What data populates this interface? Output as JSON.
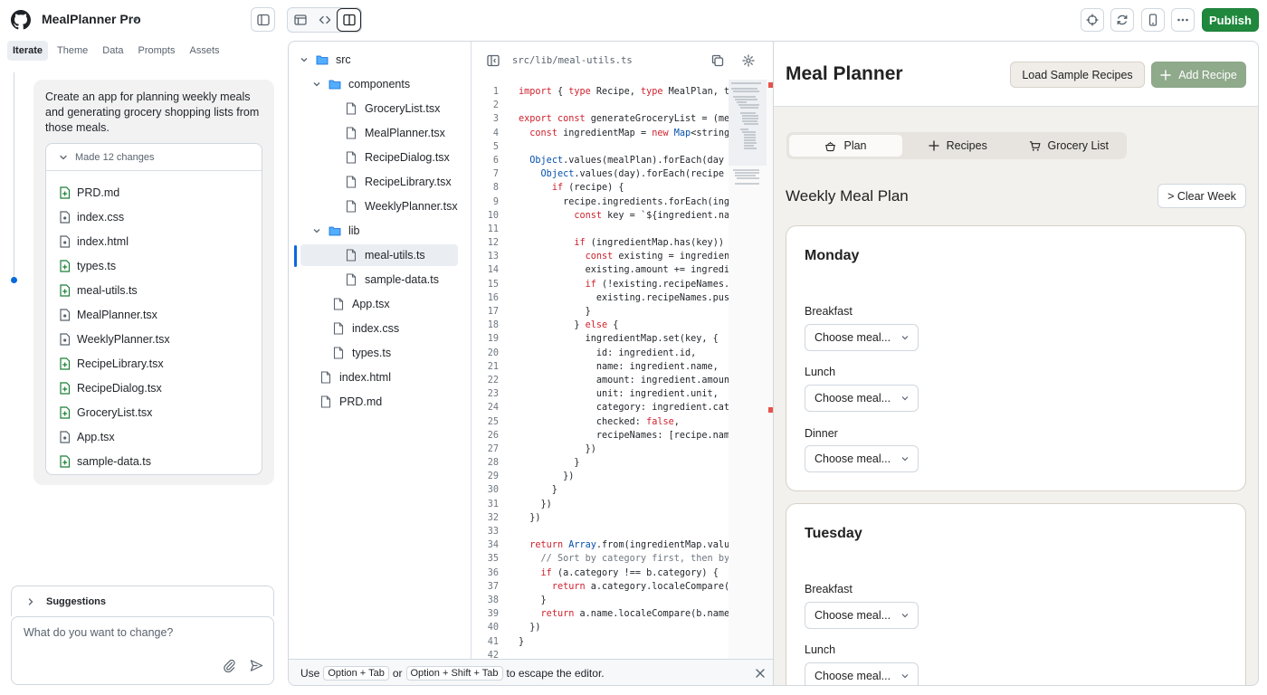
{
  "app": {
    "title": "MealPlanner Pro"
  },
  "header": {
    "publish_label": "Publish"
  },
  "left_tabs": [
    {
      "label": "Iterate",
      "active": true
    },
    {
      "label": "Theme"
    },
    {
      "label": "Data"
    },
    {
      "label": "Prompts"
    },
    {
      "label": "Assets"
    }
  ],
  "chat": {
    "message": "Create an app for planning weekly meals and generating grocery shopping lists from those meals.",
    "changes_label": "Made 12 changes",
    "files": [
      {
        "name": "PRD.md",
        "icon": "file-added-icon"
      },
      {
        "name": "index.css",
        "icon": "file-modified-icon"
      },
      {
        "name": "index.html",
        "icon": "file-modified-icon"
      },
      {
        "name": "types.ts",
        "icon": "file-added-icon"
      },
      {
        "name": "meal-utils.ts",
        "icon": "file-added-icon"
      },
      {
        "name": "MealPlanner.tsx",
        "icon": "file-modified-icon"
      },
      {
        "name": "WeeklyPlanner.tsx",
        "icon": "file-modified-icon"
      },
      {
        "name": "RecipeLibrary.tsx",
        "icon": "file-added-icon"
      },
      {
        "name": "RecipeDialog.tsx",
        "icon": "file-added-icon"
      },
      {
        "name": "GroceryList.tsx",
        "icon": "file-added-icon"
      },
      {
        "name": "App.tsx",
        "icon": "file-modified-icon"
      },
      {
        "name": "sample-data.ts",
        "icon": "file-added-icon"
      }
    ],
    "suggestions_label": "Suggestions",
    "input_placeholder": "What do you want to change?"
  },
  "tree": [
    {
      "name": "src",
      "type": "folder"
    },
    {
      "name": "components",
      "type": "folder"
    },
    {
      "name": "GroceryList.tsx",
      "type": "file"
    },
    {
      "name": "MealPlanner.tsx",
      "type": "file"
    },
    {
      "name": "RecipeDialog.tsx",
      "type": "file"
    },
    {
      "name": "RecipeLibrary.tsx",
      "type": "file"
    },
    {
      "name": "WeeklyPlanner.tsx",
      "type": "file"
    },
    {
      "name": "lib",
      "type": "folder"
    },
    {
      "name": "meal-utils.ts",
      "type": "file",
      "selected": true
    },
    {
      "name": "sample-data.ts",
      "type": "file"
    },
    {
      "name": "App.tsx",
      "type": "file"
    },
    {
      "name": "index.css",
      "type": "file"
    },
    {
      "name": "types.ts",
      "type": "file"
    },
    {
      "name": "index.html",
      "type": "file"
    },
    {
      "name": "PRD.md",
      "type": "file"
    }
  ],
  "editor": {
    "path": "src/lib/meal-utils.ts",
    "lines": [
      "import { type Recipe, type MealPlan, t",
      "",
      "export const generateGroceryList = (me",
      "  const ingredientMap = new Map<string",
      "",
      "  Object.values(mealPlan).forEach(day",
      "    Object.values(day).forEach(recipe",
      "      if (recipe) {",
      "        recipe.ingredients.forEach(ing",
      "          const key = `${ingredient.na",
      "",
      "          if (ingredientMap.has(key))",
      "            const existing = ingredien",
      "            existing.amount += ingredi",
      "            if (!existing.recipeNames.",
      "              existing.recipeNames.pus",
      "            }",
      "          } else {",
      "            ingredientMap.set(key, {",
      "              id: ingredient.id,",
      "              name: ingredient.name,",
      "              amount: ingredient.amoun",
      "              unit: ingredient.unit,",
      "              category: ingredient.cat",
      "              checked: false,",
      "              recipeNames: [recipe.nam",
      "            })",
      "          }",
      "        })",
      "      }",
      "    })",
      "  })",
      "",
      "  return Array.from(ingredientMap.valu",
      "    // Sort by category first, then by",
      "    if (a.category !== b.category) {",
      "      return a.category.localeCompare(",
      "    }",
      "    return a.name.localeCompare(b.name",
      "  })",
      "}",
      ""
    ],
    "status_prefix": "Use",
    "status_key1": "Option + Tab",
    "status_or": "or",
    "status_key2": "Option + Shift + Tab",
    "status_suffix": "to escape the editor."
  },
  "preview": {
    "title": "Meal Planner",
    "load_sample_label": "Load Sample Recipes",
    "add_recipe_label": "Add Recipe",
    "tabs": [
      {
        "label": "Plan",
        "icon": "pot-icon",
        "active": true
      },
      {
        "label": "Recipes",
        "icon": "plus-icon"
      },
      {
        "label": "Grocery List",
        "icon": "cart-icon"
      }
    ],
    "section_title": "Weekly Meal Plan",
    "clear_week_label": "> Clear Week",
    "days": [
      {
        "name": "Monday",
        "meals": [
          {
            "label": "Breakfast",
            "value": "Choose meal..."
          },
          {
            "label": "Lunch",
            "value": "Choose meal..."
          },
          {
            "label": "Dinner",
            "value": "Choose meal..."
          }
        ]
      },
      {
        "name": "Tuesday",
        "meals": [
          {
            "label": "Breakfast",
            "value": "Choose meal..."
          },
          {
            "label": "Lunch",
            "value": "Choose meal..."
          }
        ]
      }
    ]
  },
  "colors": {
    "publish": "#1f883d",
    "accent": "#0969da",
    "add_recipe": "#8fa98b",
    "preview_bg": "#f3f1ed"
  }
}
